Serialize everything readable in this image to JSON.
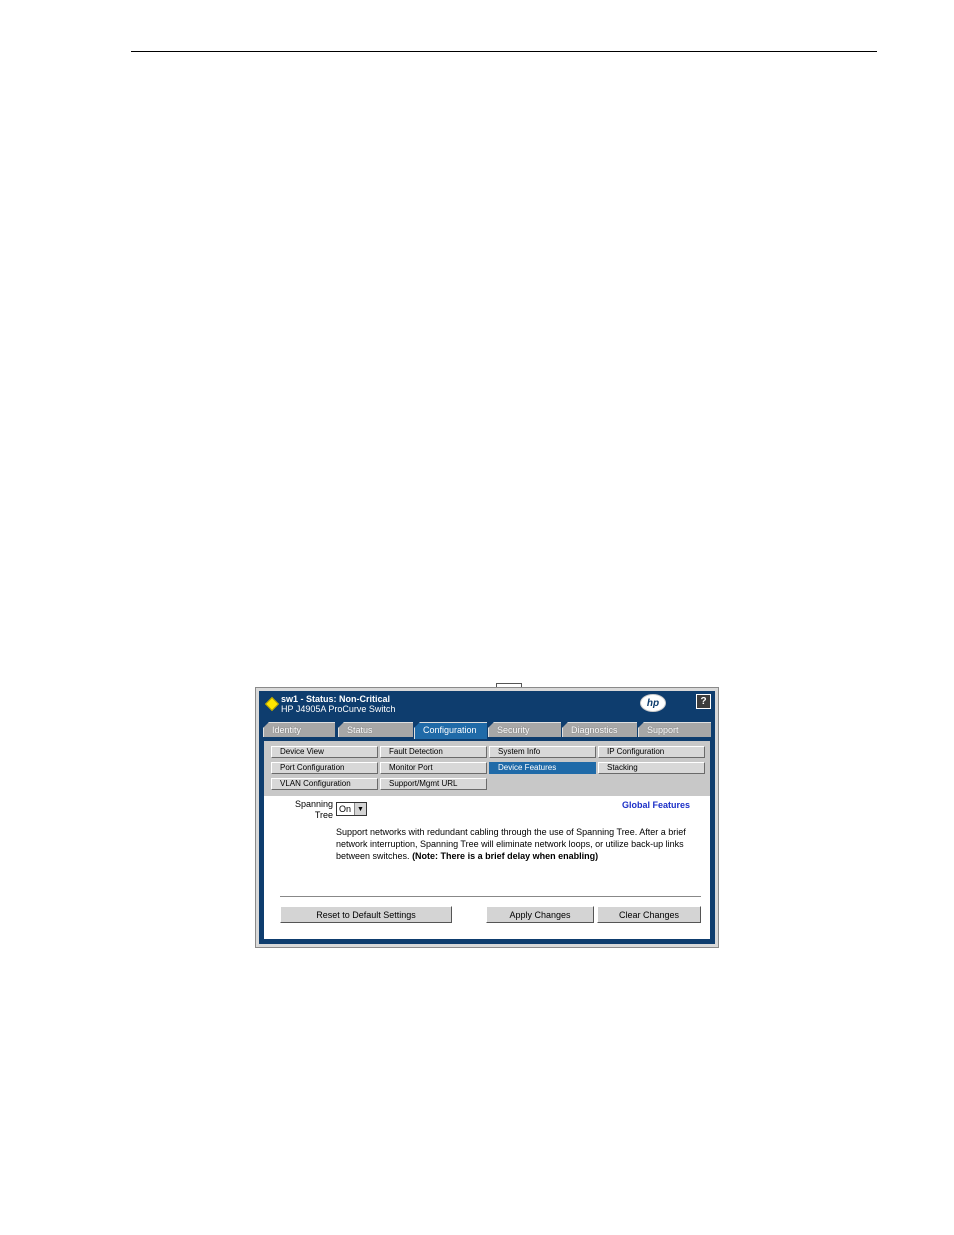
{
  "window": {
    "title_device": "sw1",
    "title_status_label": " - Status: ",
    "title_status_value": "Non-Critical",
    "subtitle": "HP J4905A ProCurve Switch",
    "logo": "hp",
    "help": "?",
    "status_color": "#ffe600"
  },
  "tabs": [
    {
      "label": "Identity"
    },
    {
      "label": "Status"
    },
    {
      "label": "Configuration"
    },
    {
      "label": "Security"
    },
    {
      "label": "Diagnostics"
    },
    {
      "label": "Support"
    }
  ],
  "subnav": [
    {
      "label": "Device View"
    },
    {
      "label": "Fault Detection"
    },
    {
      "label": "System Info"
    },
    {
      "label": "IP Configuration"
    },
    {
      "label": "Port Configuration"
    },
    {
      "label": "Monitor Port"
    },
    {
      "label": "Device Features"
    },
    {
      "label": "Stacking"
    },
    {
      "label": "VLAN Configuration"
    },
    {
      "label": "Support/Mgmt URL"
    }
  ],
  "form": {
    "spanning_tree_label": "Spanning Tree",
    "spanning_tree_value": "On",
    "section_title": "Global Features",
    "description": "Support networks with redundant cabling through the use of Spanning Tree. After a brief network interruption, Spanning Tree will eliminate network loops, or utilize back-up links between switches.",
    "note": "(Note: There is a brief delay when enabling)"
  },
  "buttons": {
    "reset": "Reset to Default Settings",
    "apply": "Apply Changes",
    "clear": "Clear Changes"
  },
  "colors": {
    "frame_blue": "#0e3d6e",
    "active_blue": "#1f6aa8",
    "link_blue": "#1b2fc7"
  }
}
